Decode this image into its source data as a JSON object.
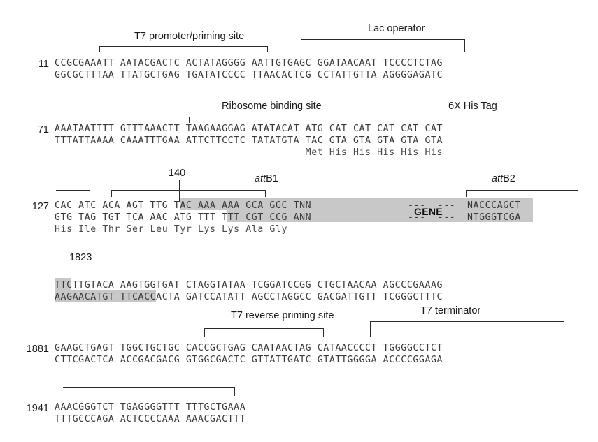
{
  "figure": {
    "title": "pDEST17 expression region sequence map",
    "highlight_color": "#c8c8c8",
    "line_color": "#2b2b2b"
  },
  "annotations": {
    "t7_promoter": "T7 promoter/priming site",
    "lac_operator": "Lac operator",
    "rbs": "Ribosome binding site",
    "his_tag": "6X His Tag",
    "attb1_ital": "att",
    "attb1_rest": "B1",
    "attb2_ital": "att",
    "attb2_rest": "B2",
    "t7_reverse": "T7 reverse priming site",
    "t7_terminator": "T7 terminator",
    "mark_140": "140",
    "mark_1823": "1823",
    "gene_label": "GENE"
  },
  "blocks": [
    {
      "coord": "11",
      "top": "CCGCGAAATT AATACGACTC ACTATAGGGG AATTGTGAGC GGATAACAAT TCCCCTCTAG",
      "bottom": "GGCGCTTTAA TTATGCTGAG TGATATCCCC TTAACACTCG CCTATTGTTA AGGGGAGATC",
      "aa": ""
    },
    {
      "coord": "71",
      "top": "AAATAATTTT GTTTAAACTT TAAGAAGGAG ATATACAT ATG CAT CAT CAT CAT CAT",
      "bottom": "TTTATTAAAA CAAATTTGAA ATTCTTCCTC TATATGTA TAC GTA GTA GTA GTA GTA",
      "aa": "                                          Met His His His His His"
    },
    {
      "coord": "127",
      "top": "CAC ATC ACA AGT TTG TAC AAA AAA GCA GGC TNN",
      "bottom": "GTG TAG TGT TCA AAC ATG TTT TTT CGT CCG ANN",
      "aa": "His Ile Thr Ser Leu Tyr Lys Lys Ala Gly",
      "top_tail": "NACCCAGCT",
      "bottom_tail": "NTGGGTCGA",
      "gene_dashes_top": "---  ---",
      "gene_dashes_bottom": "---  ---"
    },
    {
      "coord": "",
      "top": "TTCTTGTACA AAGTGGTGAT CTAGGTATAA TCGGATCCGG CTGCTAACAA AGCCCGAAAG",
      "bottom": "AAGAACATGT TTCACCACTA GATCCATATT AGCCTAGGCC GACGATTGTT TCGGGCTTTC",
      "aa": ""
    },
    {
      "coord": "1881",
      "top": "GAAGCTGAGT TGGCTGCTGC CACCGCTGAG CAATAACTAG CATAACCCCT TGGGGCCTCT",
      "bottom": "CTTCGACTCA ACCGACGACG GTGGCGACTC GTTATTGATC GTATTGGGGA ACCCCGGAGA",
      "aa": ""
    },
    {
      "coord": "1941",
      "top": "AAACGGGTCT TGAGGGGTTT TTTGCTGAAA",
      "bottom": "TTTGCCCAGA ACTCCCCAAA AAACGACTTT",
      "aa": ""
    }
  ]
}
